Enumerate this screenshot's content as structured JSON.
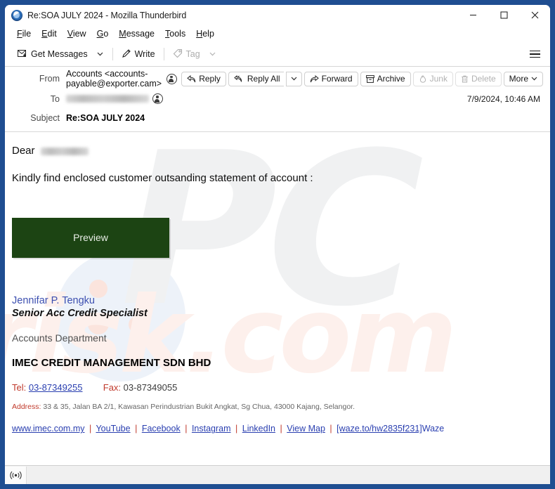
{
  "window": {
    "title": "Re:SOA JULY 2024 - Mozilla Thunderbird",
    "app_icon": "thunderbird-icon",
    "controls": {
      "minimize": "minimize-icon",
      "maximize": "maximize-icon",
      "close": "close-icon"
    }
  },
  "menubar": {
    "items": [
      {
        "label": "File",
        "accesskey": "F"
      },
      {
        "label": "Edit",
        "accesskey": "E"
      },
      {
        "label": "View",
        "accesskey": "V"
      },
      {
        "label": "Go",
        "accesskey": "G"
      },
      {
        "label": "Message",
        "accesskey": "M"
      },
      {
        "label": "Tools",
        "accesskey": "T"
      },
      {
        "label": "Help",
        "accesskey": "H"
      }
    ]
  },
  "toolbar": {
    "get_messages": "Get Messages",
    "write": "Write",
    "tag": "Tag",
    "tag_disabled": true,
    "app_menu": "hamburger-icon"
  },
  "message_header": {
    "from_label": "From",
    "from_value": "Accounts <accounts-payable@exporter.cam>",
    "to_label": "To",
    "to_value_redacted": true,
    "subject_label": "Subject",
    "subject_value": "Re:SOA JULY 2024",
    "date": "7/9/2024, 10:46 AM",
    "actions": [
      {
        "label": "Reply",
        "icon": "reply-icon",
        "disabled": false
      },
      {
        "label": "Reply All",
        "icon": "reply-all-icon",
        "disabled": false
      },
      {
        "label": "Forward",
        "icon": "forward-icon",
        "disabled": false
      },
      {
        "label": "Archive",
        "icon": "archive-icon",
        "disabled": false
      },
      {
        "label": "Junk",
        "icon": "junk-icon",
        "disabled": true
      },
      {
        "label": "Delete",
        "icon": "trash-icon",
        "disabled": true
      },
      {
        "label": "More",
        "icon": "chevron-down-icon",
        "disabled": false
      }
    ]
  },
  "body": {
    "greeting": "Dear",
    "greeting_name_redacted": true,
    "paragraph": "Kindly find enclosed customer outsanding statement of account :",
    "preview_button": "Preview",
    "preview_button_color": "#1c4413",
    "signature": {
      "name": "Jennifar P. Tengku",
      "name_color": "#3c4fb0",
      "title": "Senior Acc Credit Specialist",
      "department": "Accounts Department",
      "company": "IMEC CREDIT MANAGEMENT SDN BHD",
      "tel_label": "Tel:",
      "tel_value": "03-87349255",
      "fax_label": "Fax:",
      "fax_value": "03-87349055",
      "address_label": "Address:",
      "address_value": "33 & 35, Jalan BA 2/1, Kawasan Perindustrian Bukit Angkat, Sg Chua, 43000 Kajang, Selangor.",
      "label_color": "#c0392b",
      "link_color": "#2a3fb0"
    },
    "footer_links": [
      "www.imec.com.my",
      "YouTube",
      "Facebook",
      "Instagram",
      "LinkedIn",
      "View Map"
    ],
    "footer_separator": "|",
    "waze_link": "[waze.to/hw2835f231]",
    "waze_label": "Waze"
  },
  "watermark": {
    "primary": "PC",
    "secondary": "risk.com"
  },
  "statusbar": {
    "icon": "broadcast-icon"
  }
}
